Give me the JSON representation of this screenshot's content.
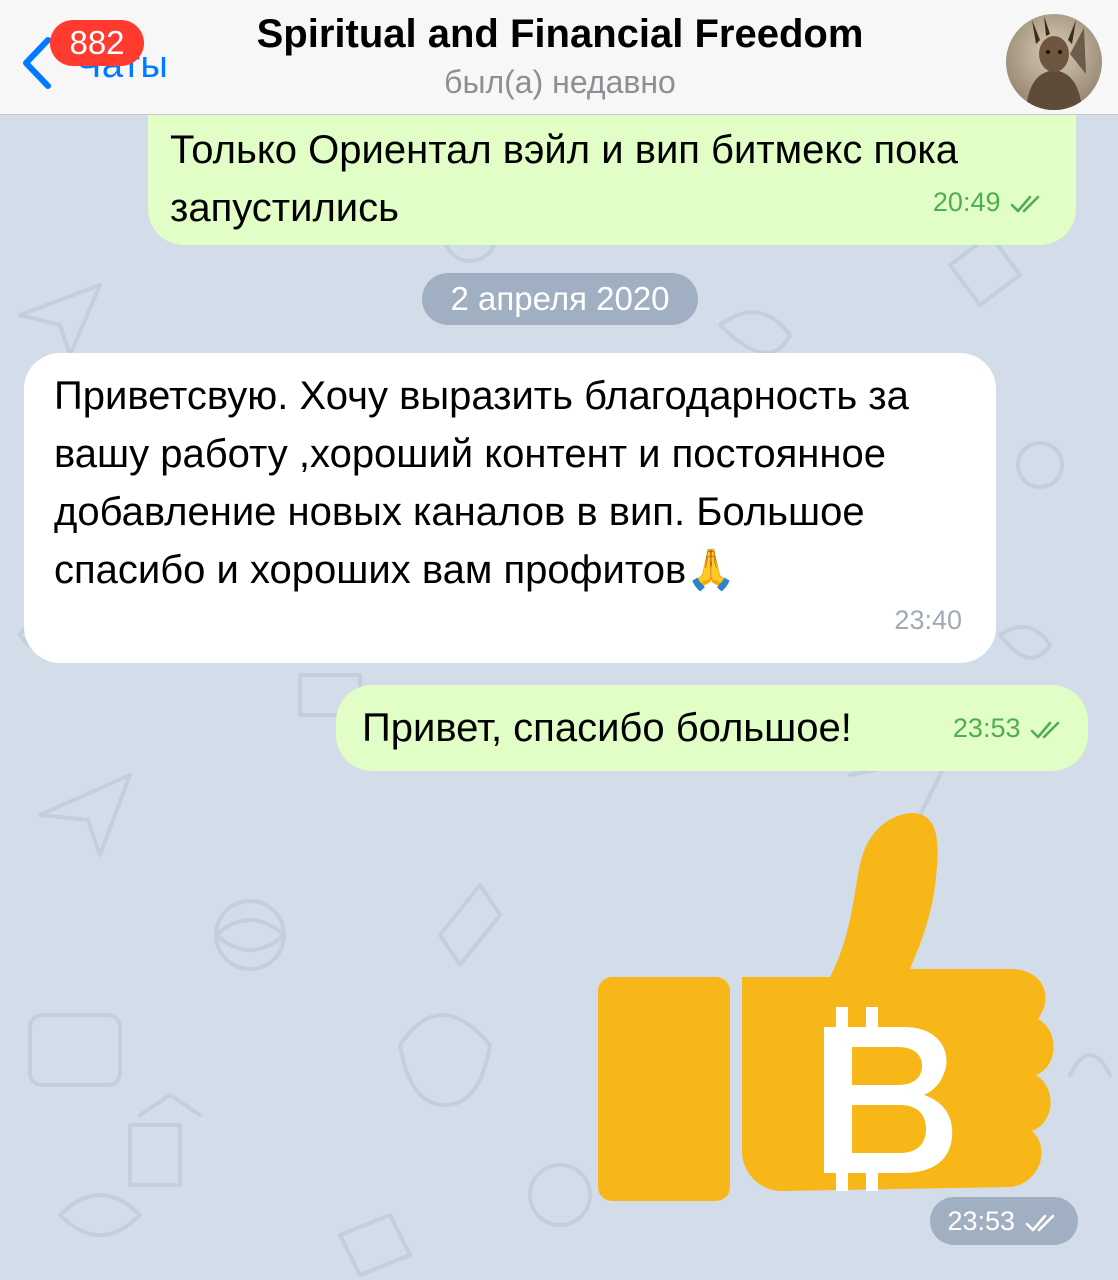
{
  "header": {
    "back_label": "Чаты",
    "unread_badge": "882",
    "chat_title": "Spiritual and Financial Freedom",
    "status": "был(а) недавно"
  },
  "messages": [
    {
      "direction": "outgoing",
      "text": "Только Ориентал вэйл и вип битмекс пока запустились",
      "time": "20:49",
      "read": true
    },
    {
      "type": "date_separator",
      "text": "2 апреля 2020"
    },
    {
      "direction": "incoming",
      "text": "Приветсвую. Хочу выразить благодарность за вашу работу ,хороший контент и постоянное добавление новых каналов в вип. Большое спасибо и хороших вам профитов🙏",
      "time": "23:40"
    },
    {
      "direction": "outgoing",
      "text": "Привет, спасибо большое!",
      "time": "23:53",
      "read": true
    },
    {
      "direction": "outgoing",
      "type": "sticker",
      "sticker_icon": "bitcoin-thumbs-up-icon",
      "time": "23:53",
      "read": true
    }
  ],
  "colors": {
    "accent": "#007aff",
    "badge": "#ff3b30",
    "outgoing_bubble": "#e1fec6",
    "incoming_bubble": "#ffffff",
    "wallpaper": "#d3dde9",
    "sticker_yellow": "#f7b719",
    "check_green": "#4fae4e"
  }
}
